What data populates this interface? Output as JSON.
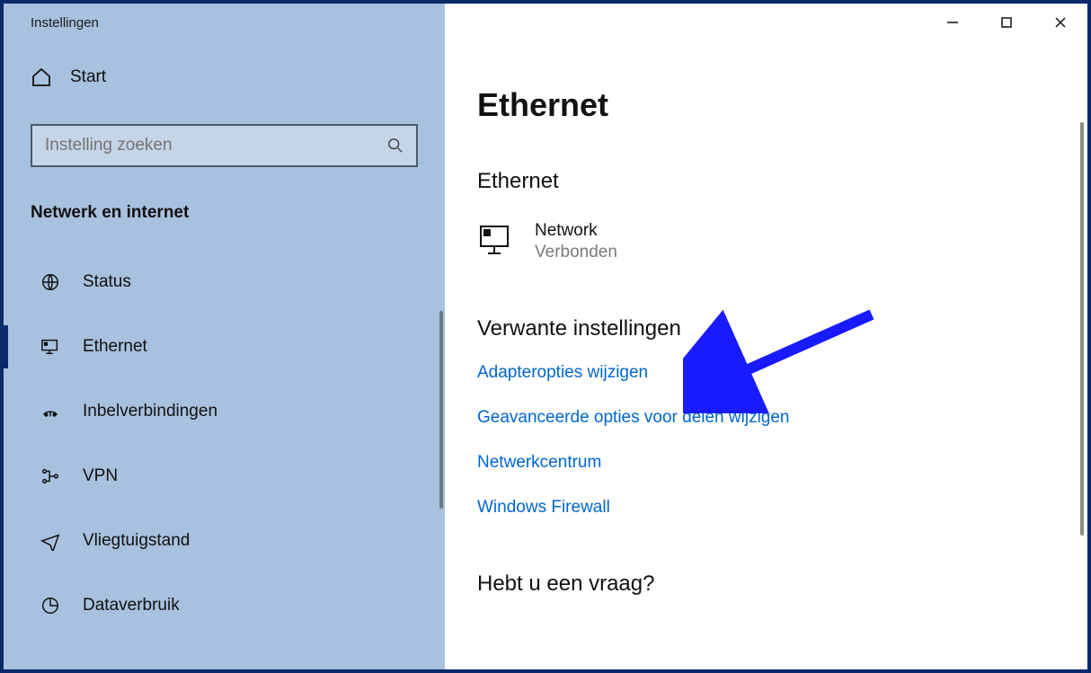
{
  "window": {
    "title": "Instellingen"
  },
  "sidebar": {
    "home_label": "Start",
    "search_placeholder": "Instelling zoeken",
    "category_title": "Netwerk en internet",
    "items": [
      {
        "label": "Status"
      },
      {
        "label": "Ethernet"
      },
      {
        "label": "Inbelverbindingen"
      },
      {
        "label": "VPN"
      },
      {
        "label": "Vliegtuigstand"
      },
      {
        "label": "Dataverbruik"
      }
    ]
  },
  "main": {
    "title": "Ethernet",
    "section_title": "Ethernet",
    "connection": {
      "name": "Network",
      "status": "Verbonden"
    },
    "related_title": "Verwante instellingen",
    "links": [
      "Adapteropties wijzigen",
      "Geavanceerde opties voor delen wijzigen",
      "Netwerkcentrum",
      "Windows Firewall"
    ],
    "question_title": "Hebt u een vraag?"
  }
}
